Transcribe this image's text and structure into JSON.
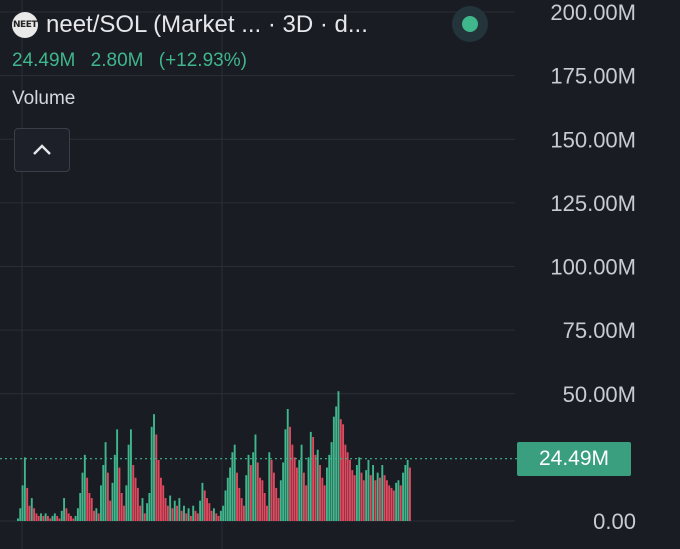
{
  "header": {
    "logo_text": "NEET",
    "title": "neet/SOL (Market ... · 3D · d...",
    "last_value": "24.49M",
    "change_value": "2.80M",
    "change_percent": "(+12.93%)",
    "indicator_label": "Volume"
  },
  "price_tag": "24.49M",
  "colors": {
    "background": "#1a1c24",
    "grid": "#2b2e37",
    "up": "#3fb68b",
    "down": "#e0495e",
    "accent": "#3a9f7e"
  },
  "icons": {
    "collapse": "chevron-up-icon",
    "live": "live-status-dot-icon"
  },
  "chart_data": {
    "type": "bar",
    "title": "",
    "xlabel": "",
    "ylabel": "",
    "ylim": [
      0,
      200000000
    ],
    "yticks": [
      "0.00",
      "50.00M",
      "75.00M",
      "100.00M",
      "125.00M",
      "150.00M",
      "175.00M",
      "200.00M"
    ],
    "ytick_values": [
      0,
      50000000,
      75000000,
      100000000,
      125000000,
      150000000,
      175000000,
      200000000
    ],
    "grid": true,
    "current_value": 24490000,
    "series": [
      {
        "values": [
          1,
          5,
          14,
          25,
          13,
          6,
          9,
          5,
          3,
          2,
          3,
          2,
          3,
          2,
          1,
          2,
          3,
          2,
          1,
          4,
          9,
          5,
          3,
          2,
          1,
          2,
          5,
          11,
          19,
          26,
          17,
          11,
          9,
          4,
          5,
          3,
          14,
          22,
          31,
          19,
          8,
          15,
          26,
          36,
          21,
          11,
          6,
          14,
          30,
          36,
          22,
          17,
          13,
          6,
          9,
          3,
          7,
          11,
          37,
          42,
          34,
          24,
          17,
          14,
          9,
          6,
          10,
          5,
          8,
          6,
          9,
          4,
          6,
          3,
          5,
          2,
          6,
          4,
          3,
          8,
          15,
          12,
          9,
          7,
          4,
          5,
          3,
          2,
          4,
          6,
          12,
          17,
          21,
          27,
          30,
          19,
          13,
          9,
          6,
          18,
          26,
          22,
          27,
          34,
          23,
          17,
          16,
          11,
          6,
          27,
          24,
          19,
          13,
          9,
          16,
          23,
          36,
          44,
          37,
          30,
          25,
          21,
          24,
          30,
          19,
          14,
          25,
          35,
          33,
          26,
          28,
          22,
          17,
          14,
          21,
          26,
          31,
          41,
          45,
          51,
          40,
          38,
          30,
          27,
          24,
          20,
          18,
          22,
          25,
          19,
          16,
          20,
          24,
          18,
          22,
          16,
          19,
          17,
          22,
          18,
          16,
          14,
          13,
          12,
          15,
          16,
          14,
          19,
          22,
          24,
          21
        ],
        "directions": [
          "up",
          "up",
          "up",
          "up",
          "down",
          "down",
          "up",
          "down",
          "down",
          "down",
          "up",
          "down",
          "up",
          "down",
          "down",
          "up",
          "up",
          "down",
          "down",
          "up",
          "up",
          "down",
          "down",
          "down",
          "down",
          "up",
          "up",
          "up",
          "up",
          "up",
          "down",
          "down",
          "down",
          "down",
          "up",
          "down",
          "up",
          "up",
          "up",
          "down",
          "down",
          "up",
          "up",
          "up",
          "down",
          "down",
          "down",
          "up",
          "up",
          "up",
          "down",
          "down",
          "down",
          "down",
          "up",
          "down",
          "up",
          "up",
          "up",
          "up",
          "down",
          "down",
          "down",
          "down",
          "down",
          "down",
          "up",
          "down",
          "up",
          "down",
          "up",
          "down",
          "up",
          "down",
          "up",
          "down",
          "up",
          "down",
          "down",
          "up",
          "up",
          "down",
          "down",
          "down",
          "down",
          "up",
          "down",
          "down",
          "up",
          "up",
          "up",
          "up",
          "up",
          "up",
          "up",
          "down",
          "down",
          "down",
          "down",
          "up",
          "up",
          "down",
          "up",
          "up",
          "down",
          "down",
          "down",
          "down",
          "down",
          "up",
          "down",
          "down",
          "down",
          "down",
          "up",
          "up",
          "up",
          "up",
          "down",
          "down",
          "down",
          "down",
          "up",
          "up",
          "down",
          "down",
          "up",
          "up",
          "down",
          "down",
          "up",
          "down",
          "down",
          "down",
          "up",
          "up",
          "up",
          "up",
          "up",
          "up",
          "down",
          "down",
          "down",
          "down",
          "down",
          "down",
          "down",
          "up",
          "up",
          "down",
          "down",
          "up",
          "up",
          "down",
          "up",
          "down",
          "up",
          "down",
          "up",
          "down",
          "down",
          "down",
          "down",
          "down",
          "up",
          "up",
          "down",
          "up",
          "up",
          "up",
          "down"
        ]
      }
    ]
  }
}
